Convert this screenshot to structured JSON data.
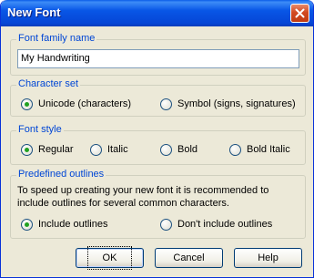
{
  "window": {
    "title": "New Font",
    "close_icon": "close-icon"
  },
  "font_family": {
    "label": "Font family name",
    "value": "My Handwriting"
  },
  "character_set": {
    "label": "Character set",
    "options": [
      {
        "label": "Unicode (characters)",
        "selected": true
      },
      {
        "label": "Symbol (signs, signatures)",
        "selected": false
      }
    ]
  },
  "font_style": {
    "label": "Font style",
    "options": [
      {
        "label": "Regular",
        "selected": true
      },
      {
        "label": "Italic",
        "selected": false
      },
      {
        "label": "Bold",
        "selected": false
      },
      {
        "label": "Bold Italic",
        "selected": false
      }
    ]
  },
  "outlines": {
    "label": "Predefined outlines",
    "description_line1": "To speed up creating your new font it is recommended to",
    "description_line2": "include outlines for several common characters.",
    "options": [
      {
        "label": "Include outlines",
        "selected": true
      },
      {
        "label": "Don't include outlines",
        "selected": false
      }
    ]
  },
  "buttons": {
    "ok": "OK",
    "cancel": "Cancel",
    "help": "Help"
  },
  "colors": {
    "titlebar": "#0a5ce8",
    "group_label": "#0046d5",
    "dialog_bg": "#ece9d8",
    "radio_dot": "#21a121"
  }
}
